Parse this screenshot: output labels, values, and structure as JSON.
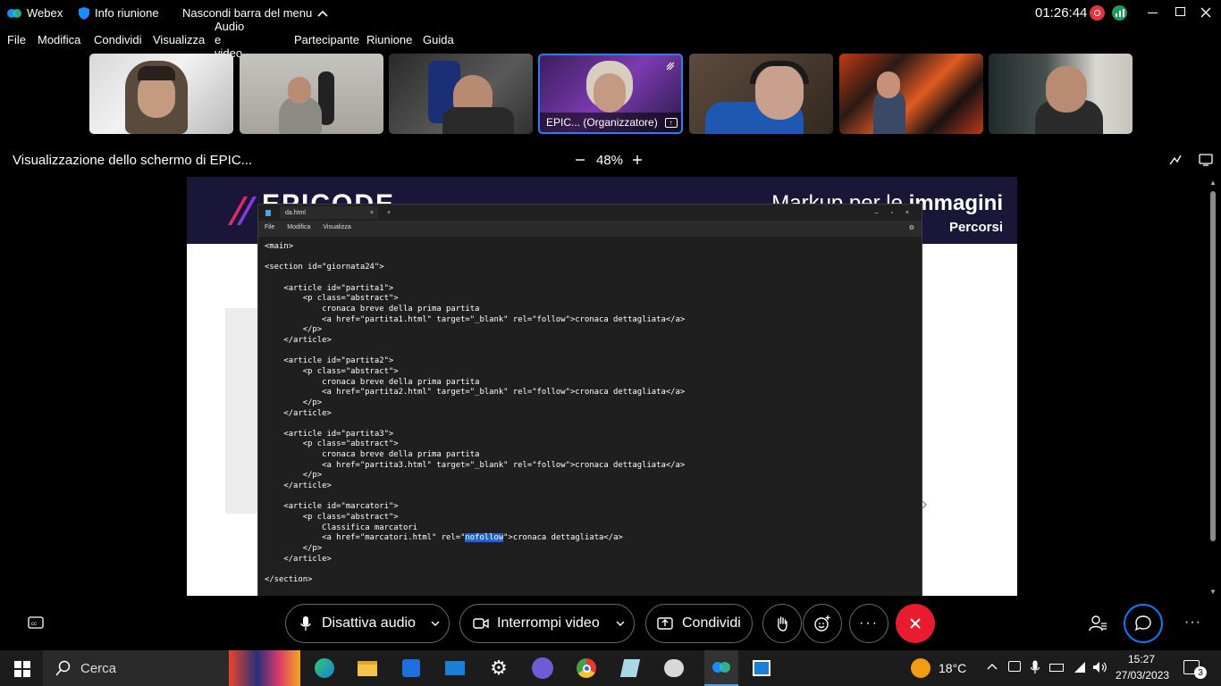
{
  "titlebar": {
    "app_name": "Webex",
    "meeting_info": "Info riunione",
    "hide_menu": "Nascondi barra del menu",
    "clock": "01:26:44"
  },
  "menu": [
    "File",
    "Modifica",
    "Condividi",
    "Visualizza",
    "Audio e video",
    "Partecipante",
    "Riunione",
    "Guida"
  ],
  "participants": {
    "host_label": "EPIC... (Organizzatore)"
  },
  "share": {
    "title": "Visualizzazione dello schermo di EPIC...",
    "zoom": "48%"
  },
  "slide": {
    "heading_part": "Markup per le",
    "heading_bold": "immagini",
    "subheading": "Percorsi",
    "brand": "EPICODE"
  },
  "editor": {
    "tab_name": "da.html",
    "menu": [
      "File",
      "Modifica",
      "Visualizza"
    ],
    "code_before": "<main>\n\n<section id=\"giornata24\">\n\n    <article id=\"partita1\">\n        <p class=\"abstract\">\n            cronaca breve della prima partita\n            <a href=\"partita1.html\" target=\"_blank\" rel=\"follow\">cronaca dettagliata</a>\n        </p>\n    </article>\n\n    <article id=\"partita2\">\n        <p class=\"abstract\">\n            cronaca breve della prima partita\n            <a href=\"partita2.html\" target=\"_blank\" rel=\"follow\">cronaca dettagliata</a>\n        </p>\n    </article>\n\n    <article id=\"partita3\">\n        <p class=\"abstract\">\n            cronaca breve della prima partita\n            <a href=\"partita3.html\" target=\"_blank\" rel=\"follow\">cronaca dettagliata</a>\n        </p>\n    </article>\n\n    <article id=\"marcatori\">\n        <p class=\"abstract\">\n            Classifica marcatori\n            <a href=\"marcatori.html\" rel=\"",
    "code_highlight": "nofollow",
    "code_after": "\">cronaca dettagliata</a>\n        </p>\n    </article>\n\n</section>"
  },
  "controls": {
    "mute": "Disattiva audio",
    "stop_video": "Interrompi video",
    "share": "Condividi"
  },
  "taskbar": {
    "search_placeholder": "Cerca",
    "weather": "18°C",
    "time": "15:27",
    "date": "27/03/2023",
    "notifications": "3"
  },
  "colors": {
    "accent": "#0a7cff",
    "leave_red": "#e81c2e",
    "record_red": "#e8323e",
    "host_border": "#2f7df6",
    "selection": "#1f63d6",
    "slide_header": "#1a1638"
  }
}
